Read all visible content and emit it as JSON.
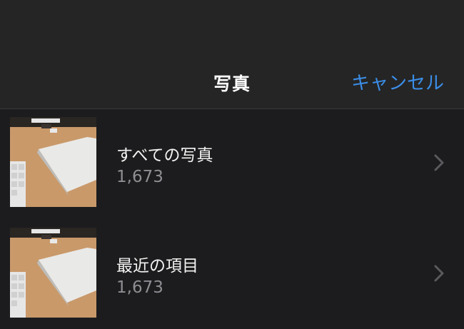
{
  "nav": {
    "title": "写真",
    "cancel_label": "キャンセル"
  },
  "albums": [
    {
      "name": "すべての写真",
      "count": "1,673",
      "icon": "chevron-right-icon"
    },
    {
      "name": "最近の項目",
      "count": "1,673",
      "icon": "chevron-right-icon"
    }
  ],
  "colors": {
    "background": "#1c1c1e",
    "nav_background": "#252525",
    "accent": "#3b8ee8",
    "secondary_text": "#8e8e93"
  }
}
